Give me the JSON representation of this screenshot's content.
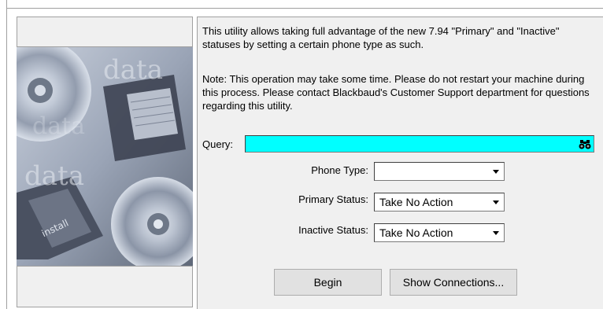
{
  "intro_text": "This utility allows taking full advantage of the new 7.94 \"Primary\" and \"Inactive\" statuses by setting a certain phone type as such.",
  "note_text": "Note:  This operation may take some time.  Please do not restart your machine during this process.  Please contact Blackbaud's Customer Support department for questions regarding this utility.",
  "query": {
    "label": "Query:",
    "value": "",
    "highlight_color": "#00ffff",
    "icon": "binoculars-icon"
  },
  "fields": {
    "phone_type": {
      "label": "Phone Type:",
      "value": ""
    },
    "primary_status": {
      "label": "Primary Status:",
      "value": "Take No Action"
    },
    "inactive_status": {
      "label": "Inactive Status:",
      "value": "Take No Action"
    }
  },
  "buttons": {
    "begin": "Begin",
    "show_connections": "Show Connections..."
  },
  "artwork": {
    "text": [
      "data",
      "data",
      "data",
      "install"
    ]
  }
}
